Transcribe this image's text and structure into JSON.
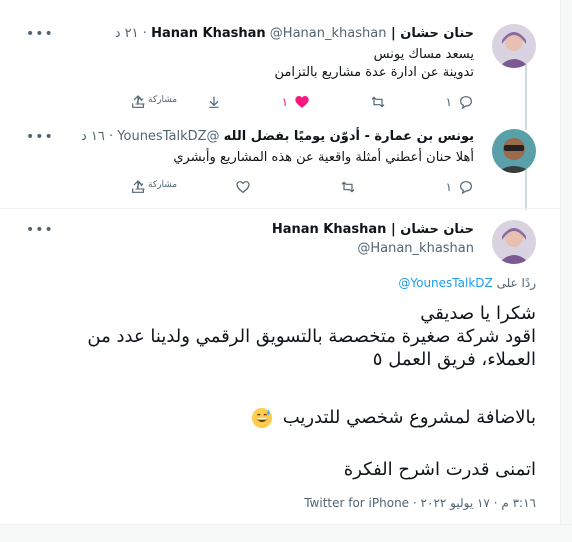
{
  "tweets": [
    {
      "name": "حنان حشان | Hanan Khashan",
      "handle": "@Hanan_khashan",
      "dot": "·",
      "time": "٢١ د",
      "lines": [
        "يسعد مساك يونس",
        "تدوينة عن ادارة عدة مشاريع بالتزامن"
      ],
      "replies": "١",
      "likes": "١",
      "share": "مشاركة"
    },
    {
      "name": "يونس بن عمارة - أدوّن يوميًا بفضل الله",
      "handle": "@YounesTalkDZ",
      "dot": "·",
      "time": "١٦ د",
      "lines": [
        "أهلا حنان أعطني أمثلة واقعية عن هذه المشاريع وأبشري"
      ],
      "replies": "١",
      "share": "مشاركة"
    }
  ],
  "main": {
    "name": "حنان حشان | Hanan Khashan",
    "handle": "@Hanan_khashan",
    "reply_prefix": "ردًا على",
    "reply_mention": "@YounesTalkDZ",
    "para1": [
      "شكرا يا صديقي",
      "اقود شركة صغيرة متخصصة بالتسويق الرقمي ولدينا عدد من",
      "العملاء، فريق العمل ٥"
    ],
    "para2": "بالاضافة لمشروع شخصي للتدريب",
    "para3": "اتمنى قدرت اشرح الفكرة",
    "time": "٣:١٦ م",
    "dot1": "·",
    "date": "١٧ يوليو ٢٠٢٢",
    "dot2": "·",
    "source": "Twitter for iPhone"
  },
  "colors": {
    "accent": "#1d9bf0",
    "like": "#f91880",
    "muted": "#536471"
  },
  "icons": [
    "more-icon",
    "reply-icon",
    "retweet-icon",
    "like-icon",
    "share-icon",
    "analytics-icon",
    "grin-sweat-emoji"
  ]
}
